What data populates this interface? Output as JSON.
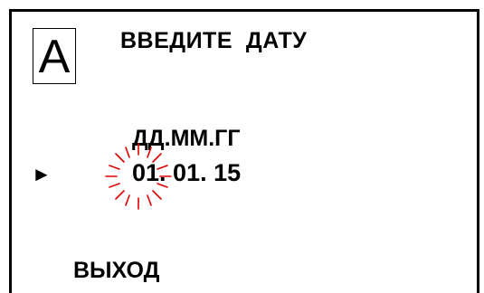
{
  "screen": {
    "mode_indicator": "A",
    "title": "ВВЕДИТЕ  ДАТУ",
    "date_format_label": "ДД.ММ.ГГ",
    "cursor_icon": "right-pointer-triangle",
    "date_value": "01. 01. 15",
    "editing_digit_indicator": "blinking-cursor",
    "blink_color": "#e00000",
    "exit_label": "ВЫХОД"
  }
}
